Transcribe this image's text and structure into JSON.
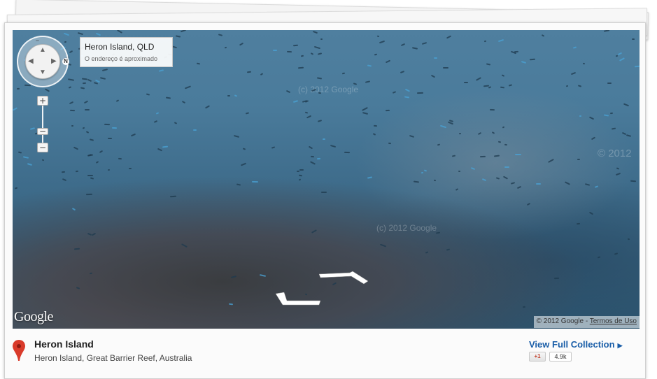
{
  "address_box": {
    "title": "Heron Island, QLD",
    "subtitle": "O endereço é aproximado"
  },
  "navigation": {
    "compass_label": "N",
    "zoom_in": "+",
    "zoom_out_small": "−",
    "zoom_out": "−",
    "arrow_up": "▲",
    "arrow_down": "▼",
    "arrow_left": "◀",
    "arrow_right": "▶"
  },
  "panorama": {
    "logo": "Google",
    "copyright": "© 2012 Google - ",
    "terms_link": "Termos de Uso",
    "watermarks": [
      "(c) 2012 Google",
      "(c) 2012 Google",
      "© 2012"
    ]
  },
  "footer": {
    "place_title": "Heron Island",
    "place_subtitle": "Heron Island, Great Barrier Reef, Australia",
    "view_full_label": "View Full Collection",
    "view_full_arrow": "▶",
    "gplus_label": "+1",
    "gplus_count": "4.9k"
  },
  "colors": {
    "link": "#1a5ea8",
    "pin": "#d93b2b",
    "gplus": "#c2412d"
  }
}
